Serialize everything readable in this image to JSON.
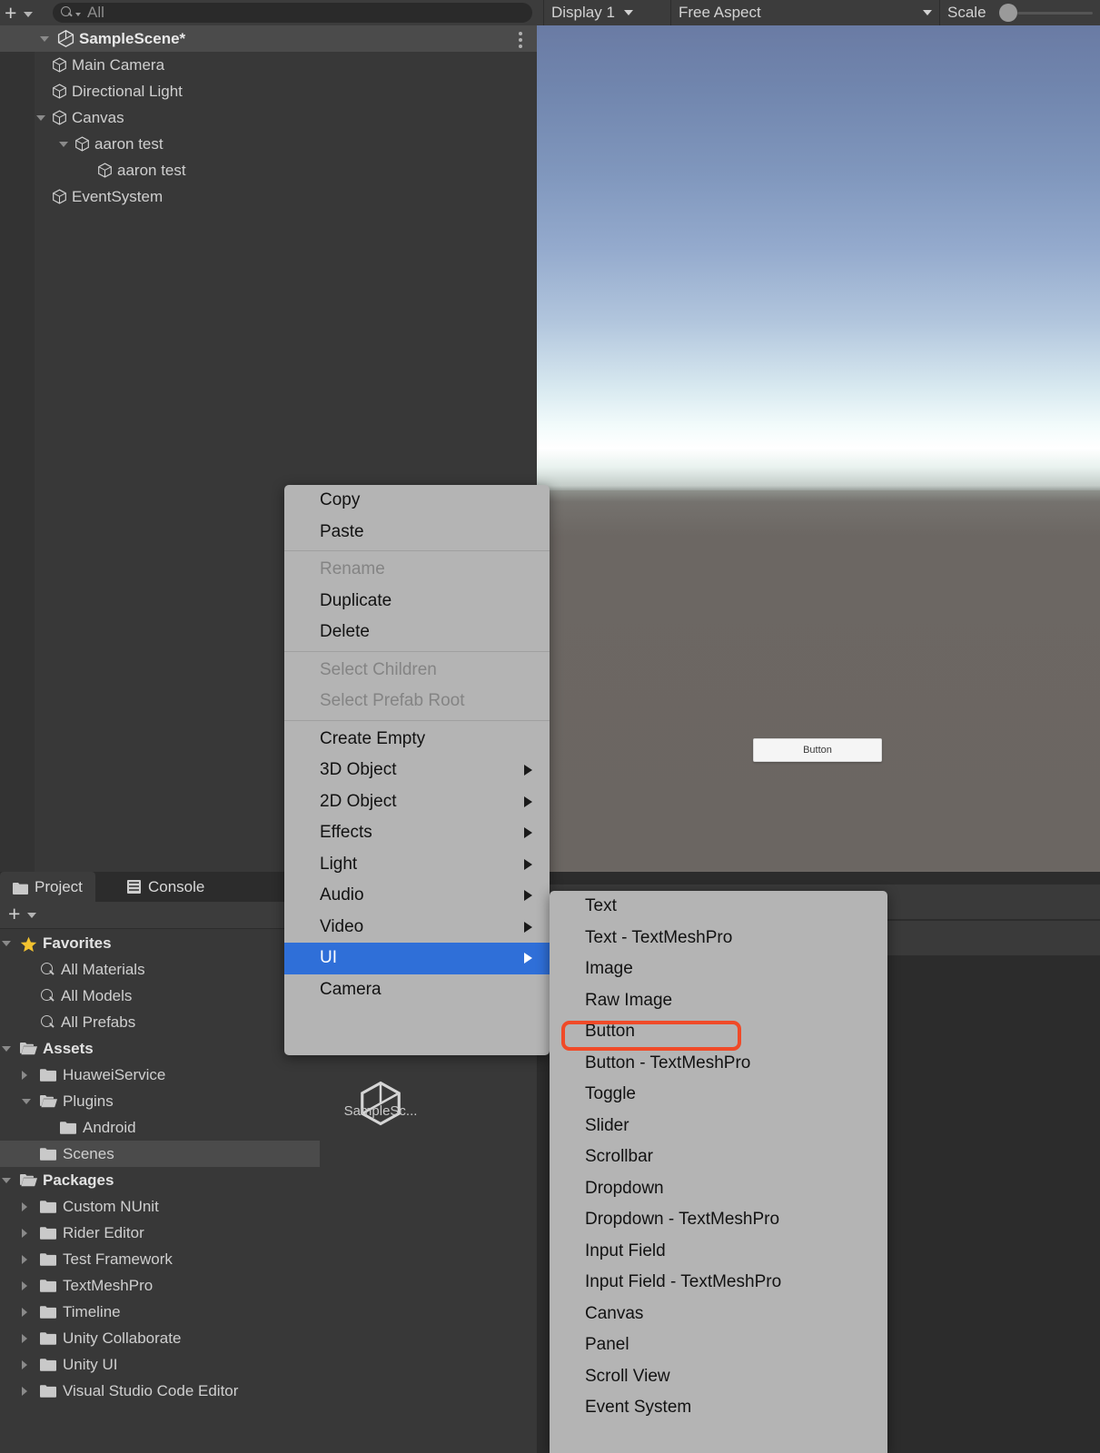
{
  "hierarchy": {
    "toolbar": {
      "add_label": "+",
      "search_placeholder": "All",
      "search_value": "",
      "add_icon": "plus-icon",
      "dropdown_icon": "chevron-down-icon",
      "search_icon": "search-icon"
    },
    "scene": {
      "name": "SampleScene*",
      "icon": "unity-scene-icon",
      "menu_icon": "kebab-menu-icon",
      "expanded": true
    },
    "items": [
      {
        "label": "Main Camera",
        "depth": 1,
        "expander": "none",
        "icon": "gameobject-cube-icon"
      },
      {
        "label": "Directional Light",
        "depth": 1,
        "expander": "none",
        "icon": "gameobject-cube-icon"
      },
      {
        "label": "Canvas",
        "depth": 1,
        "expander": "expanded",
        "icon": "gameobject-cube-icon"
      },
      {
        "label": "aaron test",
        "depth": 2,
        "expander": "expanded",
        "icon": "gameobject-cube-icon"
      },
      {
        "label": "aaron test",
        "depth": 3,
        "expander": "none",
        "icon": "gameobject-cube-icon"
      },
      {
        "label": "EventSystem",
        "depth": 1,
        "expander": "none",
        "icon": "gameobject-cube-icon"
      }
    ]
  },
  "gameview": {
    "display": "Display 1",
    "aspect": "Free Aspect",
    "scale_label": "Scale",
    "scale_value": 1,
    "button_label": "Button",
    "display_caret_icon": "chevron-down-icon",
    "aspect_caret_icon": "chevron-down-icon",
    "scale_slider_icon": "slider-handle"
  },
  "project": {
    "tabs": [
      {
        "label": "Project",
        "icon": "folder-icon",
        "active": true
      },
      {
        "label": "Console",
        "icon": "console-icon",
        "active": false
      }
    ],
    "toolbar": {
      "add_label": "+",
      "add_icon": "plus-icon",
      "dropdown_icon": "chevron-down-icon"
    },
    "tree": [
      {
        "label": "Favorites",
        "depth": 0,
        "expander": "expanded",
        "icon": "star-icon",
        "bold": true,
        "selected": false
      },
      {
        "label": "All Materials",
        "depth": 1,
        "expander": "none",
        "icon": "search-icon",
        "bold": false,
        "selected": false
      },
      {
        "label": "All Models",
        "depth": 1,
        "expander": "none",
        "icon": "search-icon",
        "bold": false,
        "selected": false
      },
      {
        "label": "All Prefabs",
        "depth": 1,
        "expander": "none",
        "icon": "search-icon",
        "bold": false,
        "selected": false
      },
      {
        "label": "Assets",
        "depth": 0,
        "expander": "expanded",
        "icon": "folder-open-icon",
        "bold": true,
        "selected": false
      },
      {
        "label": "HuaweiService",
        "depth": 1,
        "expander": "collapsed",
        "icon": "folder-icon",
        "bold": false,
        "selected": false
      },
      {
        "label": "Plugins",
        "depth": 1,
        "expander": "expanded",
        "icon": "folder-open-icon",
        "bold": false,
        "selected": false
      },
      {
        "label": "Android",
        "depth": 2,
        "expander": "none",
        "icon": "folder-icon",
        "bold": false,
        "selected": false
      },
      {
        "label": "Scenes",
        "depth": 1,
        "expander": "none",
        "icon": "folder-icon",
        "bold": false,
        "selected": true
      },
      {
        "label": "Packages",
        "depth": 0,
        "expander": "expanded",
        "icon": "folder-open-icon",
        "bold": true,
        "selected": false
      },
      {
        "label": "Custom NUnit",
        "depth": 1,
        "expander": "collapsed",
        "icon": "folder-icon",
        "bold": false,
        "selected": false
      },
      {
        "label": "Rider Editor",
        "depth": 1,
        "expander": "collapsed",
        "icon": "folder-icon",
        "bold": false,
        "selected": false
      },
      {
        "label": "Test Framework",
        "depth": 1,
        "expander": "collapsed",
        "icon": "folder-icon",
        "bold": false,
        "selected": false
      },
      {
        "label": "TextMeshPro",
        "depth": 1,
        "expander": "collapsed",
        "icon": "folder-icon",
        "bold": false,
        "selected": false
      },
      {
        "label": "Timeline",
        "depth": 1,
        "expander": "collapsed",
        "icon": "folder-icon",
        "bold": false,
        "selected": false
      },
      {
        "label": "Unity Collaborate",
        "depth": 1,
        "expander": "collapsed",
        "icon": "folder-icon",
        "bold": false,
        "selected": false
      },
      {
        "label": "Unity UI",
        "depth": 1,
        "expander": "collapsed",
        "icon": "folder-icon",
        "bold": false,
        "selected": false
      },
      {
        "label": "Visual Studio Code Editor",
        "depth": 1,
        "expander": "collapsed",
        "icon": "folder-icon",
        "bold": false,
        "selected": false
      }
    ],
    "asset_thumb": {
      "label": "SampleSc...",
      "icon": "unity-scene-asset-icon"
    }
  },
  "context_menu": {
    "groups": [
      [
        {
          "label": "Copy",
          "enabled": true,
          "submenu": false,
          "highlighted": false
        },
        {
          "label": "Paste",
          "enabled": true,
          "submenu": false,
          "highlighted": false
        }
      ],
      [
        {
          "label": "Rename",
          "enabled": false,
          "submenu": false,
          "highlighted": false
        },
        {
          "label": "Duplicate",
          "enabled": true,
          "submenu": false,
          "highlighted": false
        },
        {
          "label": "Delete",
          "enabled": true,
          "submenu": false,
          "highlighted": false
        }
      ],
      [
        {
          "label": "Select Children",
          "enabled": false,
          "submenu": false,
          "highlighted": false
        },
        {
          "label": "Select Prefab Root",
          "enabled": false,
          "submenu": false,
          "highlighted": false
        }
      ],
      [
        {
          "label": "Create Empty",
          "enabled": true,
          "submenu": false,
          "highlighted": false
        },
        {
          "label": "3D Object",
          "enabled": true,
          "submenu": true,
          "highlighted": false
        },
        {
          "label": "2D Object",
          "enabled": true,
          "submenu": true,
          "highlighted": false
        },
        {
          "label": "Effects",
          "enabled": true,
          "submenu": true,
          "highlighted": false
        },
        {
          "label": "Light",
          "enabled": true,
          "submenu": true,
          "highlighted": false
        },
        {
          "label": "Audio",
          "enabled": true,
          "submenu": true,
          "highlighted": false
        },
        {
          "label": "Video",
          "enabled": true,
          "submenu": true,
          "highlighted": false
        },
        {
          "label": "UI",
          "enabled": true,
          "submenu": true,
          "highlighted": true
        },
        {
          "label": "Camera",
          "enabled": true,
          "submenu": false,
          "highlighted": false
        }
      ]
    ]
  },
  "submenu": {
    "parent": "UI",
    "items": [
      {
        "label": "Text",
        "annotated": false
      },
      {
        "label": "Text - TextMeshPro",
        "annotated": false
      },
      {
        "label": "Image",
        "annotated": false
      },
      {
        "label": "Raw Image",
        "annotated": false
      },
      {
        "label": "Button",
        "annotated": true
      },
      {
        "label": "Button - TextMeshPro",
        "annotated": false
      },
      {
        "label": "Toggle",
        "annotated": false
      },
      {
        "label": "Slider",
        "annotated": false
      },
      {
        "label": "Scrollbar",
        "annotated": false
      },
      {
        "label": "Dropdown",
        "annotated": false
      },
      {
        "label": "Dropdown - TextMeshPro",
        "annotated": false
      },
      {
        "label": "Input Field",
        "annotated": false
      },
      {
        "label": "Input Field - TextMeshPro",
        "annotated": false
      },
      {
        "label": "Canvas",
        "annotated": false
      },
      {
        "label": "Panel",
        "annotated": false
      },
      {
        "label": "Scroll View",
        "annotated": false
      },
      {
        "label": "Event System",
        "annotated": false
      }
    ]
  },
  "colors": {
    "annotation": "#f04a28",
    "menu_highlight": "#2f6fd8",
    "panel_bg": "#383838",
    "menu_bg": "#b4b4b4",
    "favorites_star": "#f2c230"
  }
}
